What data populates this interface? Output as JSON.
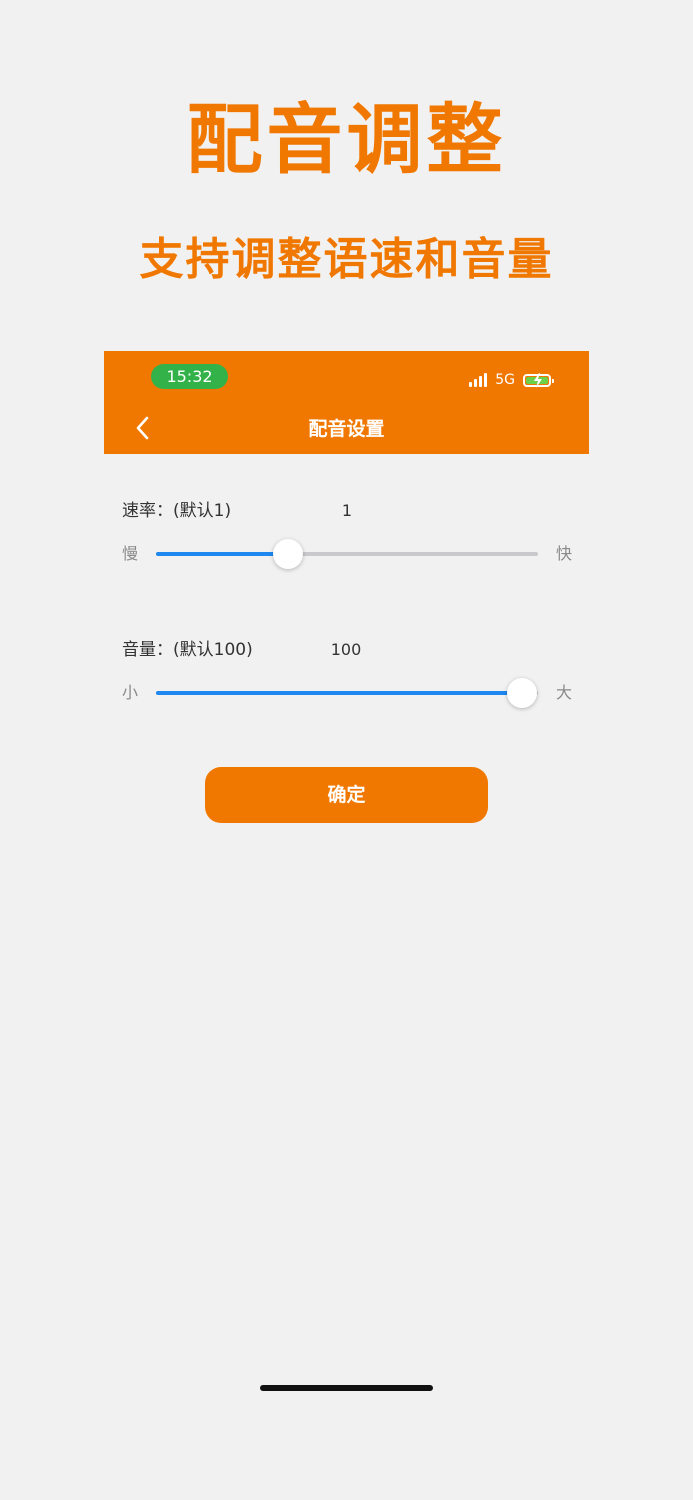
{
  "promo": {
    "title": "配音调整",
    "subtitle": "支持调整语速和音量"
  },
  "status_bar": {
    "time": "15:32",
    "network": "5G",
    "battery_charging": true
  },
  "nav": {
    "back_icon": "chevron-left-icon",
    "title": "配音设置"
  },
  "rate": {
    "label": "速率：(默认1)",
    "value": "1",
    "min_label": "慢",
    "max_label": "快",
    "fraction": 0.345
  },
  "volume": {
    "label": "音量：(默认100)",
    "value": "100",
    "min_label": "小",
    "max_label": "大",
    "fraction": 0.958
  },
  "confirm_label": "确定",
  "colors": {
    "accent": "#f07800",
    "slider_active": "#1e88f0",
    "time_pill": "#34b24a"
  }
}
